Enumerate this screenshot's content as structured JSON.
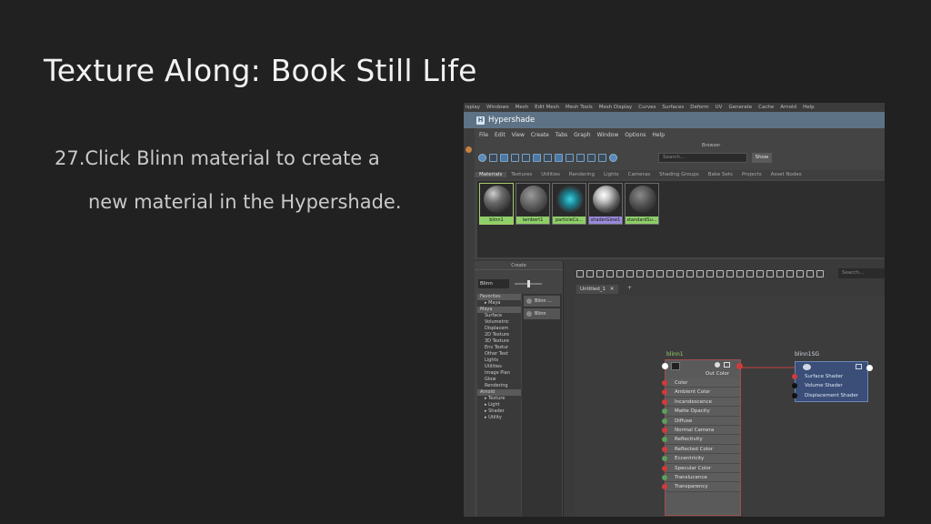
{
  "slide": {
    "title": "Texture Along: Book Still Life",
    "step_line1": "27.Click Blinn material to create a",
    "step_line2": "new material in the Hypershade."
  },
  "maya": {
    "main_menu": [
      "isplay",
      "Windows",
      "Mesh",
      "Edit Mesh",
      "Mesh Tools",
      "Mesh Display",
      "Curves",
      "Surfaces",
      "Deform",
      "UV",
      "Generate",
      "Cache",
      "Arnold",
      "Help"
    ],
    "window_title": "Hypershade",
    "hs_menu": [
      "File",
      "Edit",
      "View",
      "Create",
      "Tabs",
      "Graph",
      "Window",
      "Options",
      "Help"
    ],
    "browser_label": "Browser",
    "browser_search_placeholder": "Search...",
    "show_button": "Show",
    "browser_tabs": [
      "Materials",
      "Textures",
      "Utilities",
      "Rendering",
      "Lights",
      "Cameras",
      "Shading Groups",
      "Bake Sets",
      "Projects",
      "Asset Nodes"
    ],
    "active_tab": "Materials",
    "swatches": [
      {
        "label": "blinn1",
        "label_color": "#8fcf6a",
        "ball": "radial-gradient(circle at 35% 30%, #cfcfcf 0%, #6a6a6a 35%, #2a2a2a 80%)"
      },
      {
        "label": "lambert1",
        "label_color": "#8fcf6a",
        "ball": "radial-gradient(circle at 40% 35%, #9a9a9a 0%, #5a5a5a 50%, #2a2a2a 90%)"
      },
      {
        "label": "particleCo...",
        "label_color": "#8fcf6a",
        "ball": "radial-gradient(circle at 50% 50%, #3fd0e0 0%, #1a8090 35%, #303030 70%)"
      },
      {
        "label": "shaderGlow1",
        "label_color": "#9a8ad8",
        "ball": "radial-gradient(circle at 40% 35%, #ffffff 0%, #c8c8c8 25%, #5a5a5a 60%, #1a1a1a 90%)"
      },
      {
        "label": "standardSu...",
        "label_color": "#8fcf6a",
        "ball": "radial-gradient(circle at 40% 35%, #8a8a8a 0%, #4a4a4a 50%, #202020 90%)"
      }
    ],
    "create_panel": {
      "header": "Create",
      "filter_value": "Blinn",
      "tree": [
        {
          "label": "Favorites",
          "cat": true
        },
        {
          "label": "▸ Maya",
          "cat": false
        },
        {
          "label": "Maya",
          "cat": true
        },
        {
          "label": "Surface",
          "cat": false
        },
        {
          "label": "Volumetric",
          "cat": false
        },
        {
          "label": "Displacem",
          "cat": false
        },
        {
          "label": "2D Texture",
          "cat": false
        },
        {
          "label": "3D Texture",
          "cat": false
        },
        {
          "label": "Env Textur",
          "cat": false
        },
        {
          "label": "Other Text",
          "cat": false
        },
        {
          "label": "Lights",
          "cat": false
        },
        {
          "label": "Utilities",
          "cat": false
        },
        {
          "label": "Image Plan",
          "cat": false
        },
        {
          "label": "Glow",
          "cat": false
        },
        {
          "label": "Rendering",
          "cat": false
        },
        {
          "label": "Arnold",
          "cat": true
        },
        {
          "label": "▸ Texture",
          "cat": false
        },
        {
          "label": "▸ Light",
          "cat": false
        },
        {
          "label": "▸ Shader",
          "cat": false
        },
        {
          "label": "▸ Utility",
          "cat": false
        }
      ],
      "results": [
        "Blinn ...",
        "Blinn"
      ]
    },
    "graph": {
      "search_placeholder": "Search...",
      "tab_label": "Untitled_1",
      "tab_close": "✕",
      "tab_add": "+",
      "blinn_node": {
        "title": "blinn1",
        "output": "Out Color",
        "attributes": [
          "Color",
          "Ambient Color",
          "Incandescence",
          "Matte Opacity",
          "Diffuse",
          "Normal Camera",
          "Reflectivity",
          "Reflected Color",
          "Eccentricity",
          "Specular Color",
          "Translucence",
          "Transparency"
        ]
      },
      "sg_node": {
        "title": "blinn1SG",
        "attributes": [
          "Surface Shader",
          "Volume Shader",
          "Displacement Shader"
        ]
      }
    }
  }
}
